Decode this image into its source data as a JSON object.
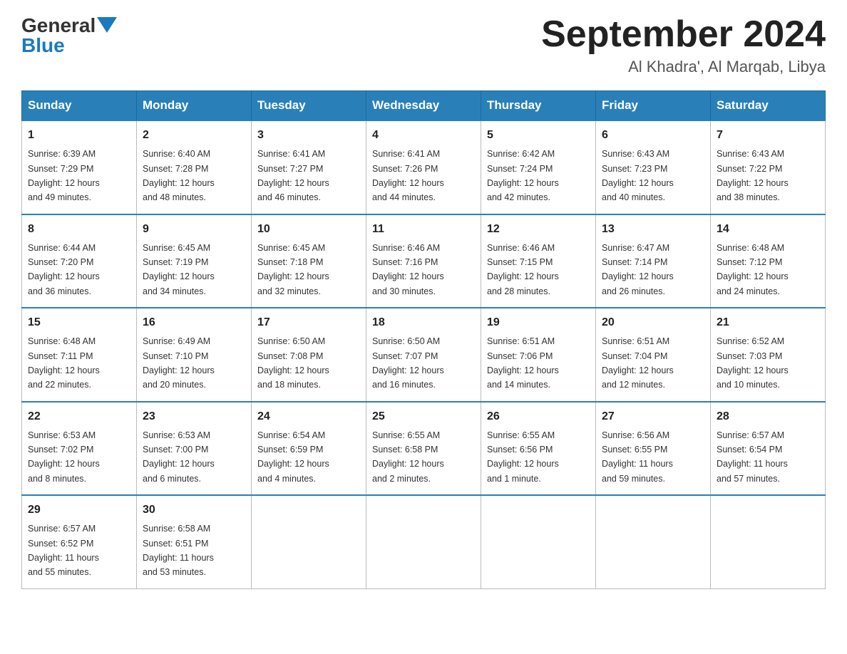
{
  "logo": {
    "general": "General",
    "blue": "Blue"
  },
  "title": "September 2024",
  "subtitle": "Al Khadra', Al Marqab, Libya",
  "days_of_week": [
    "Sunday",
    "Monday",
    "Tuesday",
    "Wednesday",
    "Thursday",
    "Friday",
    "Saturday"
  ],
  "weeks": [
    [
      {
        "day": "1",
        "sunrise": "6:39 AM",
        "sunset": "7:29 PM",
        "daylight": "12 hours and 49 minutes."
      },
      {
        "day": "2",
        "sunrise": "6:40 AM",
        "sunset": "7:28 PM",
        "daylight": "12 hours and 48 minutes."
      },
      {
        "day": "3",
        "sunrise": "6:41 AM",
        "sunset": "7:27 PM",
        "daylight": "12 hours and 46 minutes."
      },
      {
        "day": "4",
        "sunrise": "6:41 AM",
        "sunset": "7:26 PM",
        "daylight": "12 hours and 44 minutes."
      },
      {
        "day": "5",
        "sunrise": "6:42 AM",
        "sunset": "7:24 PM",
        "daylight": "12 hours and 42 minutes."
      },
      {
        "day": "6",
        "sunrise": "6:43 AM",
        "sunset": "7:23 PM",
        "daylight": "12 hours and 40 minutes."
      },
      {
        "day": "7",
        "sunrise": "6:43 AM",
        "sunset": "7:22 PM",
        "daylight": "12 hours and 38 minutes."
      }
    ],
    [
      {
        "day": "8",
        "sunrise": "6:44 AM",
        "sunset": "7:20 PM",
        "daylight": "12 hours and 36 minutes."
      },
      {
        "day": "9",
        "sunrise": "6:45 AM",
        "sunset": "7:19 PM",
        "daylight": "12 hours and 34 minutes."
      },
      {
        "day": "10",
        "sunrise": "6:45 AM",
        "sunset": "7:18 PM",
        "daylight": "12 hours and 32 minutes."
      },
      {
        "day": "11",
        "sunrise": "6:46 AM",
        "sunset": "7:16 PM",
        "daylight": "12 hours and 30 minutes."
      },
      {
        "day": "12",
        "sunrise": "6:46 AM",
        "sunset": "7:15 PM",
        "daylight": "12 hours and 28 minutes."
      },
      {
        "day": "13",
        "sunrise": "6:47 AM",
        "sunset": "7:14 PM",
        "daylight": "12 hours and 26 minutes."
      },
      {
        "day": "14",
        "sunrise": "6:48 AM",
        "sunset": "7:12 PM",
        "daylight": "12 hours and 24 minutes."
      }
    ],
    [
      {
        "day": "15",
        "sunrise": "6:48 AM",
        "sunset": "7:11 PM",
        "daylight": "12 hours and 22 minutes."
      },
      {
        "day": "16",
        "sunrise": "6:49 AM",
        "sunset": "7:10 PM",
        "daylight": "12 hours and 20 minutes."
      },
      {
        "day": "17",
        "sunrise": "6:50 AM",
        "sunset": "7:08 PM",
        "daylight": "12 hours and 18 minutes."
      },
      {
        "day": "18",
        "sunrise": "6:50 AM",
        "sunset": "7:07 PM",
        "daylight": "12 hours and 16 minutes."
      },
      {
        "day": "19",
        "sunrise": "6:51 AM",
        "sunset": "7:06 PM",
        "daylight": "12 hours and 14 minutes."
      },
      {
        "day": "20",
        "sunrise": "6:51 AM",
        "sunset": "7:04 PM",
        "daylight": "12 hours and 12 minutes."
      },
      {
        "day": "21",
        "sunrise": "6:52 AM",
        "sunset": "7:03 PM",
        "daylight": "12 hours and 10 minutes."
      }
    ],
    [
      {
        "day": "22",
        "sunrise": "6:53 AM",
        "sunset": "7:02 PM",
        "daylight": "12 hours and 8 minutes."
      },
      {
        "day": "23",
        "sunrise": "6:53 AM",
        "sunset": "7:00 PM",
        "daylight": "12 hours and 6 minutes."
      },
      {
        "day": "24",
        "sunrise": "6:54 AM",
        "sunset": "6:59 PM",
        "daylight": "12 hours and 4 minutes."
      },
      {
        "day": "25",
        "sunrise": "6:55 AM",
        "sunset": "6:58 PM",
        "daylight": "12 hours and 2 minutes."
      },
      {
        "day": "26",
        "sunrise": "6:55 AM",
        "sunset": "6:56 PM",
        "daylight": "12 hours and 1 minute."
      },
      {
        "day": "27",
        "sunrise": "6:56 AM",
        "sunset": "6:55 PM",
        "daylight": "11 hours and 59 minutes."
      },
      {
        "day": "28",
        "sunrise": "6:57 AM",
        "sunset": "6:54 PM",
        "daylight": "11 hours and 57 minutes."
      }
    ],
    [
      {
        "day": "29",
        "sunrise": "6:57 AM",
        "sunset": "6:52 PM",
        "daylight": "11 hours and 55 minutes."
      },
      {
        "day": "30",
        "sunrise": "6:58 AM",
        "sunset": "6:51 PM",
        "daylight": "11 hours and 53 minutes."
      },
      null,
      null,
      null,
      null,
      null
    ]
  ],
  "labels": {
    "sunrise": "Sunrise:",
    "sunset": "Sunset:",
    "daylight": "Daylight:"
  }
}
